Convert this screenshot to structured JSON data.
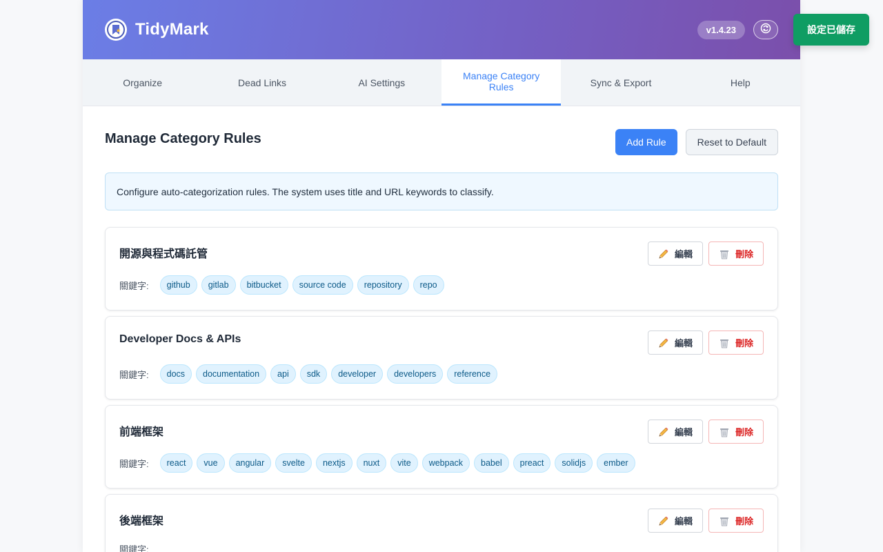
{
  "app": {
    "title": "TidyMark",
    "version": "v1.4.23",
    "logo_icon": "bookmark-star-icon",
    "sync_icon": "sync-icon"
  },
  "toast": {
    "text": "設定已儲存",
    "color": "#0f9d63"
  },
  "tabs": [
    {
      "label": "Organize",
      "active": false
    },
    {
      "label": "Dead Links",
      "active": false
    },
    {
      "label": "AI Settings",
      "active": false
    },
    {
      "label": "Manage Category Rules",
      "active": true
    },
    {
      "label": "Sync & Export",
      "active": false
    },
    {
      "label": "Help",
      "active": false
    }
  ],
  "page": {
    "title": "Manage Category Rules",
    "add_button": "Add Rule",
    "reset_button": "Reset to Default",
    "info": "Configure auto-categorization rules. The system uses title and URL keywords to classify."
  },
  "labels": {
    "edit": "編輯",
    "delete": "刪除",
    "keywords": "關鍵字:"
  },
  "rules": [
    {
      "name": "開源與程式碼託管",
      "keywords": [
        "github",
        "gitlab",
        "bitbucket",
        "source code",
        "repository",
        "repo"
      ]
    },
    {
      "name": "Developer Docs & APIs",
      "keywords": [
        "docs",
        "documentation",
        "api",
        "sdk",
        "developer",
        "developers",
        "reference"
      ]
    },
    {
      "name": "前端框架",
      "keywords": [
        "react",
        "vue",
        "angular",
        "svelte",
        "nextjs",
        "nuxt",
        "vite",
        "webpack",
        "babel",
        "preact",
        "solidjs",
        "ember"
      ]
    },
    {
      "name": "後端框架",
      "keywords": []
    }
  ],
  "colors": {
    "accent": "#3b82f6",
    "header_gradient_start": "#6b7ee6",
    "header_gradient_end": "#7b4fab",
    "delete": "#dc2626",
    "chip_bg": "#e0f2fe"
  }
}
